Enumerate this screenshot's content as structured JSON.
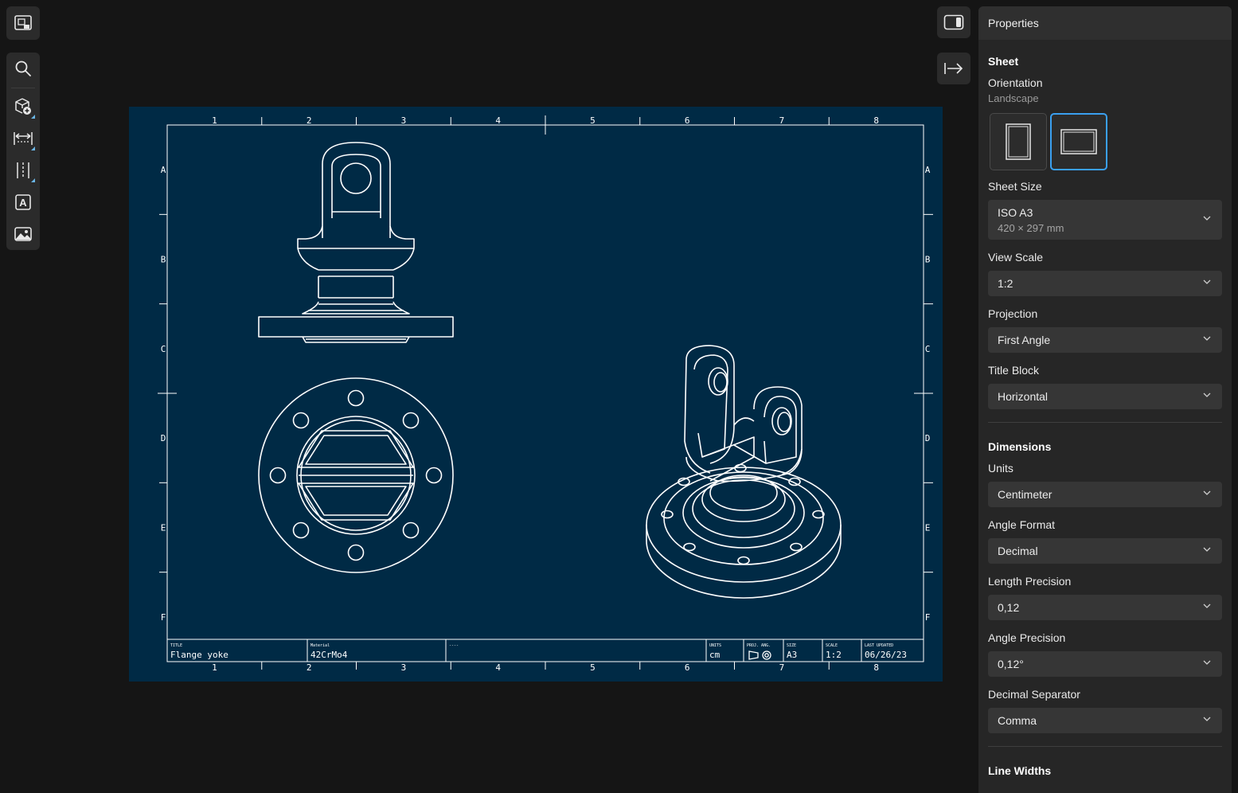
{
  "toolbar": {
    "tools": [
      {
        "icon": "drawing-sheet-icon"
      },
      {
        "icon": "search-icon"
      },
      {
        "icon": "add-view-icon"
      },
      {
        "icon": "dimension-icon"
      },
      {
        "icon": "centerline-icon"
      },
      {
        "icon": "text-icon",
        "glyph": "A"
      },
      {
        "icon": "image-icon"
      }
    ],
    "right": [
      {
        "icon": "toggle-panel-icon"
      },
      {
        "icon": "export-icon"
      }
    ]
  },
  "sheet": {
    "background": "#002a45",
    "line_color": "#ffffff",
    "columns": [
      "1",
      "2",
      "3",
      "4",
      "5",
      "6",
      "7",
      "8"
    ],
    "rows": [
      "A",
      "B",
      "C",
      "D",
      "E",
      "F"
    ],
    "title_block": {
      "title_label": "TITLE",
      "title": "Flange yoke",
      "material_label": "Material",
      "material": "42CrMo4",
      "blank_label": "----",
      "units_label": "UNITS",
      "units": "cm",
      "projection_label": "PROJ. ANG.",
      "size_label": "SIZE",
      "size": "A3",
      "scale_label": "SCALE",
      "scale": "1:2",
      "updated_label": "LAST UPDATED",
      "updated": "06/26/23"
    }
  },
  "panel": {
    "title": "Properties",
    "sheet_section": "Sheet",
    "orientation_label": "Orientation",
    "orientation_value": "Landscape",
    "sheet_size_label": "Sheet Size",
    "sheet_size_value": "ISO A3",
    "sheet_size_dims": "420 × 297 mm",
    "view_scale_label": "View Scale",
    "view_scale_value": "1:2",
    "projection_label": "Projection",
    "projection_value": "First Angle",
    "title_block_label": "Title Block",
    "title_block_value": "Horizontal",
    "dimensions_section": "Dimensions",
    "units_label": "Units",
    "units_value": "Centimeter",
    "angle_format_label": "Angle Format",
    "angle_format_value": "Decimal",
    "length_precision_label": "Length Precision",
    "length_precision_value": "0,12",
    "angle_precision_label": "Angle Precision",
    "angle_precision_value": "0,12°",
    "decimal_separator_label": "Decimal Separator",
    "decimal_separator_value": "Comma",
    "line_widths_section": "Line Widths",
    "accent": "#3aa0f0"
  }
}
